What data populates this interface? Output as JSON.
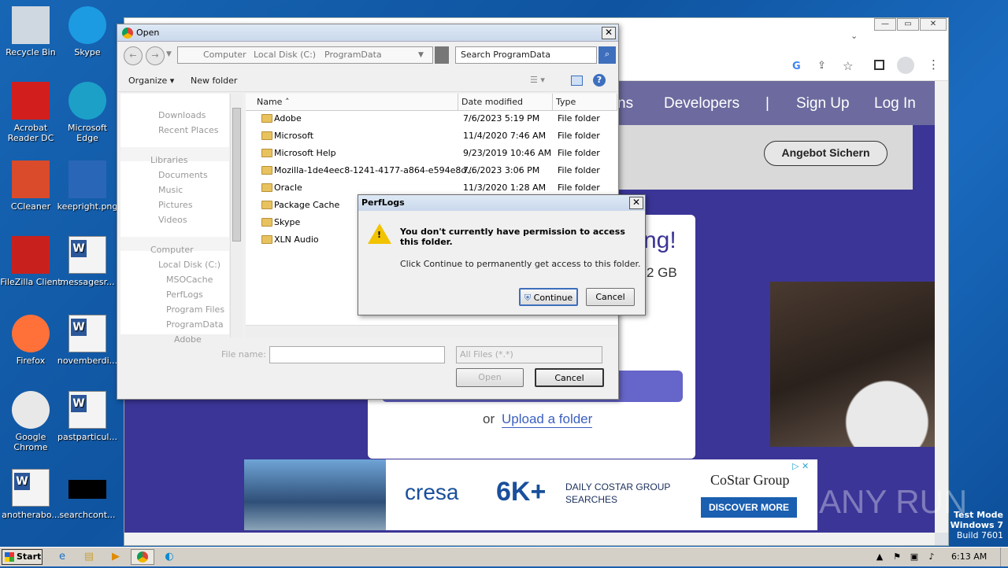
{
  "desktop_icons": [
    {
      "label": "Recycle Bin",
      "icon": "recycle-bin-icon"
    },
    {
      "label": "Skype",
      "icon": "skype-icon"
    },
    {
      "label": "Acrobat Reader DC",
      "icon": "acrobat-icon"
    },
    {
      "label": "Microsoft Edge",
      "icon": "edge-icon"
    },
    {
      "label": "CCleaner",
      "icon": "ccleaner-icon"
    },
    {
      "label": "keepright.png",
      "icon": "image-file-icon"
    },
    {
      "label": "FileZilla Client",
      "icon": "filezilla-icon"
    },
    {
      "label": "messagesr...",
      "icon": "word-doc-icon"
    },
    {
      "label": "Firefox",
      "icon": "firefox-icon"
    },
    {
      "label": "novemberdi...",
      "icon": "word-doc-icon"
    },
    {
      "label": "Google Chrome",
      "icon": "chrome-icon"
    },
    {
      "label": "pastparticul...",
      "icon": "word-doc-icon"
    },
    {
      "label": "anotherabo...",
      "icon": "word-doc-icon"
    },
    {
      "label": "searchcont...",
      "icon": "black-file-icon"
    }
  ],
  "browser": {
    "nav": [
      "ns",
      "Developers",
      "|",
      "Sign Up",
      "Log In"
    ],
    "cta": "Angebot Sichern",
    "headline_fragment": "ng!",
    "size_fragment": "2 GB",
    "upload_or": "or",
    "upload_link": "Upload a folder",
    "ad": {
      "brand": "cresa",
      "big": "6K+",
      "line1": "DAILY COSTAR GROUP",
      "line2": "SEARCHES",
      "costar": "CoStar Group",
      "button": "DISCOVER MORE"
    }
  },
  "open_dialog": {
    "title": "Open",
    "address": [
      "Computer",
      "Local Disk (C:)",
      "ProgramData"
    ],
    "search_placeholder": "Search ProgramData",
    "organize": "Organize",
    "new_folder": "New folder",
    "nav_items": [
      "Downloads",
      "Recent Places",
      "Libraries",
      "Documents",
      "Music",
      "Pictures",
      "Videos",
      "Computer",
      "Local Disk (C:)",
      "MSOCache",
      "PerfLogs",
      "Program Files",
      "ProgramData",
      "Adobe"
    ],
    "columns": [
      "Name",
      "Date modified",
      "Type"
    ],
    "rows": [
      {
        "name": "Adobe",
        "date": "7/6/2023 5:19 PM",
        "type": "File folder"
      },
      {
        "name": "Microsoft",
        "date": "11/4/2020 7:46 AM",
        "type": "File folder"
      },
      {
        "name": "Microsoft Help",
        "date": "9/23/2019 10:46 AM",
        "type": "File folder"
      },
      {
        "name": "Mozilla-1de4eec8-1241-4177-a864-e594e8d...",
        "date": "7/6/2023 3:06 PM",
        "type": "File folder"
      },
      {
        "name": "Oracle",
        "date": "11/3/2020 1:28 AM",
        "type": "File folder"
      },
      {
        "name": "Package Cache",
        "date": "",
        "type": ""
      },
      {
        "name": "Skype",
        "date": "",
        "type": ""
      },
      {
        "name": "XLN Audio",
        "date": "",
        "type": ""
      }
    ],
    "file_name_label": "File name:",
    "filter": "All Files (*.*)",
    "open": "Open",
    "cancel": "Cancel"
  },
  "perflogs_dialog": {
    "title": "PerfLogs",
    "message": "You don't currently have permission to access this folder.",
    "detail": "Click Continue to permanently get access to this folder.",
    "continue": "Continue",
    "cancel": "Cancel"
  },
  "taskbar": {
    "start": "Start",
    "time": "6:13 AM"
  },
  "watermark": {
    "mode": "Test Mode",
    "os": "Windows 7",
    "build": "Build 7601",
    "brand": "ANY RUN"
  }
}
